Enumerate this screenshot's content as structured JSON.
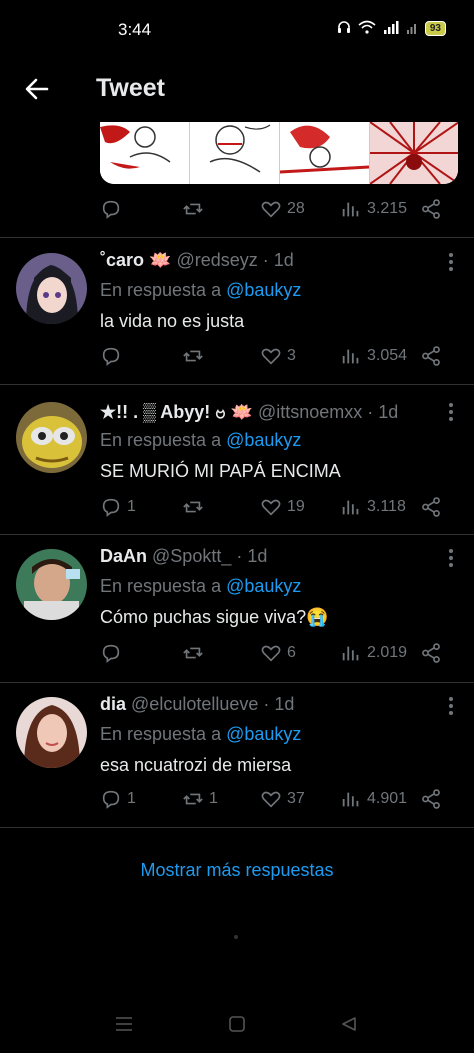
{
  "status": {
    "time": "3:44",
    "battery": "93"
  },
  "header": {
    "title": "Tweet"
  },
  "main_tweet": {
    "reply_count": "",
    "retweet_count": "",
    "like_count": "28",
    "view_count": "3.215"
  },
  "replies": [
    {
      "name": "˚caro 🪷",
      "handle": "@redseyz",
      "time": "· 1d",
      "reply_to_label": "En respuesta a ",
      "reply_to_handle": "@baukyz",
      "text": "la vida no es justa",
      "reply_count": "",
      "retweet_count": "",
      "like_count": "3",
      "view_count": "3.054"
    },
    {
      "name": "★!! . ▒ Abyy! ဗ 🪷",
      "handle": "@ittsnoemxx",
      "time": "· 1d",
      "reply_to_label": "En respuesta a ",
      "reply_to_handle": "@baukyz",
      "text": "SE MURIÓ MI PAPÁ ENCIMA",
      "reply_count": "1",
      "retweet_count": "",
      "like_count": "19",
      "view_count": "3.118"
    },
    {
      "name": "DaAn",
      "handle": "@Spoktt_",
      "time": "· 1d",
      "reply_to_label": "En respuesta a ",
      "reply_to_handle": "@baukyz",
      "text": "Cómo puchas sigue viva?😭",
      "reply_count": "",
      "retweet_count": "",
      "like_count": "6",
      "view_count": "2.019"
    },
    {
      "name": "dia",
      "handle": "@elculotellueve",
      "time": "· 1d",
      "reply_to_label": "En respuesta a ",
      "reply_to_handle": "@baukyz",
      "text": "esa ncuatrozi de miersa",
      "reply_count": "1",
      "retweet_count": "1",
      "like_count": "37",
      "view_count": "4.901"
    }
  ],
  "show_more": "Mostrar más respuestas",
  "colors": {
    "background": "#000000",
    "accent": "#1d9bf0",
    "muted": "#71767b",
    "text": "#e7e9ea"
  }
}
